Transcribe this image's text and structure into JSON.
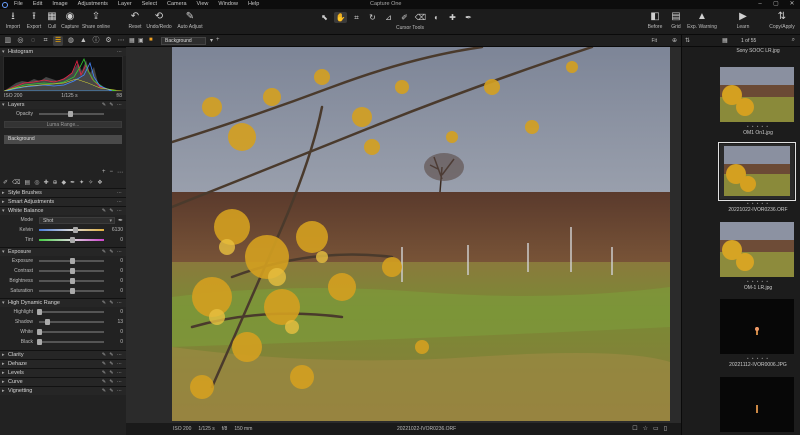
{
  "app": {
    "title": "Capture One"
  },
  "menu": [
    "File",
    "Edit",
    "Image",
    "Adjustments",
    "Layer",
    "Select",
    "Camera",
    "View",
    "Window",
    "Help"
  ],
  "toolbar": {
    "left": [
      {
        "label": "Import",
        "icon": "import-icon"
      },
      {
        "label": "Export",
        "icon": "export-icon"
      },
      {
        "label": "Cull",
        "icon": "cull-icon"
      },
      {
        "label": "Capture",
        "icon": "capture-icon"
      },
      {
        "label": "Share online",
        "icon": "share-online-icon"
      }
    ],
    "middle": [
      {
        "label": "Reset",
        "icon": "reset-icon"
      },
      {
        "label": "Undo/Redo",
        "icon": "undo-redo-icon"
      },
      {
        "label": "Auto Adjust",
        "icon": "auto-adjust-icon"
      }
    ],
    "cursor_tools_label": "Cursor Tools",
    "right": [
      {
        "label": "Before",
        "icon": "before-icon"
      },
      {
        "label": "Grid",
        "icon": "grid-icon"
      },
      {
        "label": "Exp. Warning",
        "icon": "exposure-warning-icon"
      },
      {
        "label": "Learn",
        "icon": "learn-icon"
      },
      {
        "label": "Copy/Apply",
        "icon": "copy-apply-icon"
      }
    ]
  },
  "histogram": {
    "title": "Histogram",
    "iso": "ISO 200",
    "shutter": "1/125 s",
    "aperture": "f/8"
  },
  "layers": {
    "title": "Layers",
    "opacity_label": "Opacity",
    "luma_range": "Luma Range...",
    "items": [
      "Background"
    ]
  },
  "panels": {
    "style_brushes": "Style Brushes",
    "smart_adjustments": "Smart Adjustments",
    "white_balance": {
      "title": "White Balance",
      "mode_label": "Mode",
      "mode_value": "Shot",
      "kelvin_label": "Kelvin",
      "kelvin_value": "6130",
      "kelvin_level": 0.55,
      "tint_label": "Tint",
      "tint_value": "0",
      "tint_level": 0.5
    },
    "exposure": {
      "title": "Exposure",
      "rows": [
        {
          "label": "Exposure",
          "value": "0",
          "level": 0.5
        },
        {
          "label": "Contrast",
          "value": "0",
          "level": 0.5
        },
        {
          "label": "Brightness",
          "value": "0",
          "level": 0.5
        },
        {
          "label": "Saturation",
          "value": "0",
          "level": 0.5
        }
      ]
    },
    "hdr": {
      "title": "High Dynamic Range",
      "rows": [
        {
          "label": "Highlight",
          "value": "0",
          "level": 0.0
        },
        {
          "label": "Shadow",
          "value": "13",
          "level": 0.13
        },
        {
          "label": "White",
          "value": "0",
          "level": 0.0
        },
        {
          "label": "Black",
          "value": "0",
          "level": 0.0
        }
      ]
    },
    "clarity": "Clarity",
    "dehaze": "Dehaze",
    "levels": "Levels",
    "curve": "Curve",
    "vignetting": "Vignetting"
  },
  "viewer": {
    "layer_select": "Background",
    "fit_label": "Fit",
    "iso": "ISO 200",
    "shutter": "1/125 s",
    "aperture": "f/8",
    "focal": "150 mm",
    "filename": "20221022-IVOR0236.ORF"
  },
  "browser": {
    "count": "1 of 55",
    "items": [
      {
        "name": "Sony SOOC LR.jpg",
        "stars": "• • • • •"
      },
      {
        "name": "OM1 On1.jpg",
        "stars": "• • • • •"
      },
      {
        "name": "20221022-IVOR0236.ORF",
        "stars": "• • • • •",
        "selected": true
      },
      {
        "name": "OM-1 LR.jpg",
        "stars": "• • • • •"
      },
      {
        "name": "20221112-IVOR0006.JPG",
        "stars": "• • • • •"
      }
    ]
  }
}
